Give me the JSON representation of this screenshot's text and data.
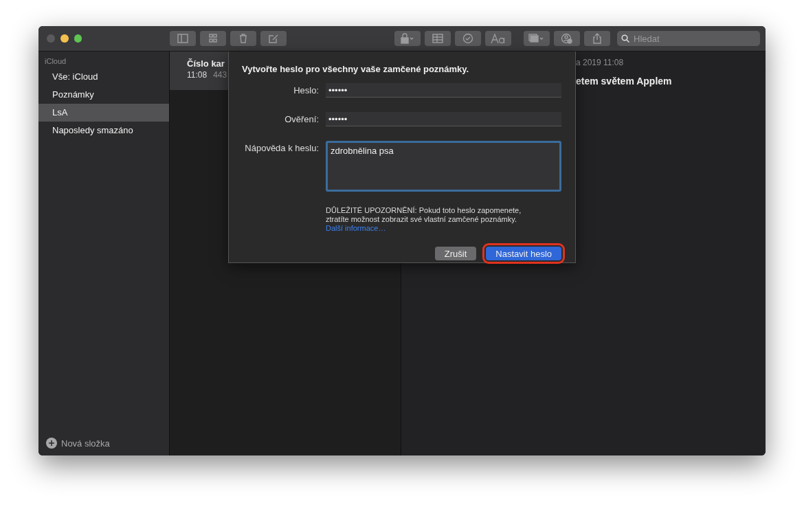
{
  "sidebar": {
    "section": "iCloud",
    "items": [
      {
        "label": "Vše: iCloud",
        "selected": false
      },
      {
        "label": "Poznámky",
        "selected": false
      },
      {
        "label": "LsA",
        "selected": true
      },
      {
        "label": "Naposledy smazáno",
        "selected": false
      }
    ],
    "new_folder": "Nová složka"
  },
  "toolbar": {
    "search": {
      "placeholder": "Hledat"
    }
  },
  "notes": [
    {
      "title": "Číslo kar",
      "time": "11:08",
      "preview": "443",
      "selected": true
    }
  ],
  "note": {
    "date": "a 2019 11:08",
    "title": "etem světem Applem"
  },
  "dialog": {
    "heading": "Vytvořte heslo pro všechny vaše zamčené poznámky.",
    "fields": [
      {
        "label": "Heslo:",
        "value": "••••••",
        "kind": "line",
        "focused": false
      },
      {
        "label": "Ověření:",
        "value": "••••••",
        "kind": "line",
        "focused": false
      },
      {
        "label": "Nápověda k heslu:",
        "value": "zdrobnělina psa",
        "kind": "area",
        "focused": true
      }
    ],
    "warning": "DŮLEŽITÉ UPOZORNĚNÍ: Pokud toto heslo zapomenete, ztratíte možnost zobrazit své vlastní zamčené poznámky.",
    "link": "Další informace…",
    "buttons": [
      {
        "label": "Zrušit",
        "kind": "secondary",
        "highlighted": false
      },
      {
        "label": "Nastavit heslo",
        "kind": "primary",
        "highlighted": true
      }
    ]
  }
}
